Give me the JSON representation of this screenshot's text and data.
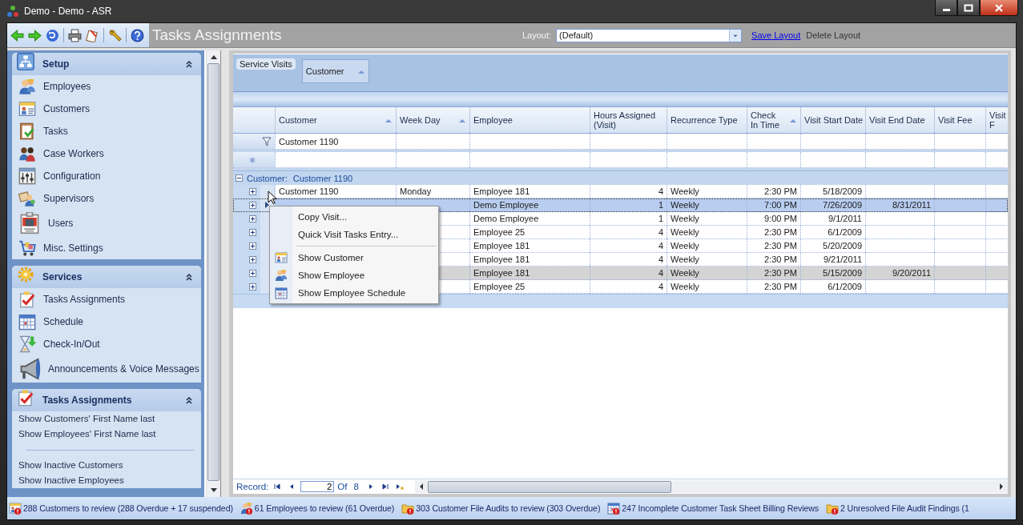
{
  "window": {
    "title": "Demo - Demo - ASR"
  },
  "toolbar": {
    "title": "Tasks Assignments",
    "layout_label": "Layout:",
    "layout_value": "(Default)",
    "save_link": "Save Layout",
    "delete_link": "Delete Layout"
  },
  "sidebar": {
    "groups": [
      {
        "title": "Setup",
        "expanded": true,
        "items": [
          "Employees",
          "Customers",
          "Tasks",
          "Case Workers",
          "Configuration",
          "Supervisors",
          "Users",
          "Misc. Settings"
        ]
      },
      {
        "title": "Services",
        "expanded": true,
        "items": [
          "Tasks Assignments",
          "Schedule",
          "Check-In/Out",
          "Announcements & Voice Messages"
        ]
      },
      {
        "title": "Tasks Assignments",
        "expanded": true,
        "link_sets": [
          [
            "Show Customers' First Name last",
            "Show Employees' First Name last"
          ],
          [
            "Show Inactive Customers",
            "Show Inactive Employees"
          ]
        ]
      }
    ]
  },
  "grid": {
    "group_panel": {
      "label": "Service Visits",
      "group_by": "Customer"
    },
    "columns": [
      {
        "label": "Customer",
        "sorted": true
      },
      {
        "label": "Week Day",
        "sorted": true
      },
      {
        "label": "Employee",
        "sorted": false
      },
      {
        "label": "Hours Assigned (Visit)",
        "sorted": false
      },
      {
        "label": "Recurrence Type",
        "sorted": false
      },
      {
        "label": "Check In Time",
        "sorted": true
      },
      {
        "label": "Visit Start Date",
        "sorted": false
      },
      {
        "label": "Visit End Date",
        "sorted": false
      },
      {
        "label": "Visit Fee",
        "sorted": false
      },
      {
        "label": "Visit F"
      }
    ],
    "filter": {
      "customer": "Customer 1190"
    },
    "group_row": {
      "label": "Customer:",
      "value": "Customer 1190",
      "expanded": true
    },
    "rows": [
      {
        "customer": "Customer 1190",
        "week_day": "Monday",
        "employee": "Employee 181",
        "hours": "4",
        "recurrence": "Weekly",
        "check_in": "2:30 PM",
        "start_date": "5/18/2009",
        "selected": false,
        "highlighted": false,
        "expanded": false
      },
      {
        "employee": "Demo Employee",
        "hours": "1",
        "recurrence": "Weekly",
        "check_in": "7:00 PM",
        "start_date": "7/26/2009",
        "end_date": "8/31/2011",
        "selected": true,
        "highlighted": false,
        "expanded": false
      },
      {
        "employee": "Demo Employee",
        "hours": "1",
        "recurrence": "Weekly",
        "check_in": "9:00 PM",
        "start_date": "9/1/2011",
        "selected": false,
        "highlighted": false,
        "expanded": false
      },
      {
        "employee": "Employee 25",
        "hours": "4",
        "recurrence": "Weekly",
        "check_in": "2:30 PM",
        "start_date": "6/1/2009",
        "selected": false,
        "highlighted": false,
        "expanded": false
      },
      {
        "employee": "Employee 181",
        "hours": "4",
        "recurrence": "Weekly",
        "check_in": "2:30 PM",
        "start_date": "5/20/2009",
        "selected": false,
        "highlighted": false,
        "expanded": false
      },
      {
        "employee": "Employee 181",
        "hours": "4",
        "recurrence": "Weekly",
        "check_in": "2:30 PM",
        "start_date": "9/21/2011",
        "selected": false,
        "highlighted": false,
        "expanded": false
      },
      {
        "employee": "Employee 181",
        "hours": "4",
        "recurrence": "Weekly",
        "check_in": "2:30 PM",
        "start_date": "5/15/2009",
        "end_date": "9/20/2011",
        "selected": false,
        "highlighted": true,
        "expanded": false
      },
      {
        "employee": "Employee 25",
        "hours": "4",
        "recurrence": "Weekly",
        "check_in": "2:30 PM",
        "start_date": "6/1/2009",
        "selected": false,
        "highlighted": false,
        "expanded": false
      }
    ],
    "context_menu": [
      {
        "kind": "command",
        "label": "Copy Visit..."
      },
      {
        "kind": "command",
        "label": "Quick Visit Tasks Entry..."
      },
      {
        "kind": "separator"
      },
      {
        "kind": "command",
        "label": "Show Customer"
      },
      {
        "kind": "command",
        "label": "Show Employee"
      },
      {
        "kind": "command",
        "label": "Show Employee Schedule"
      }
    ],
    "navigator": {
      "label": "Record:",
      "current": "2",
      "of": "Of",
      "total": "8"
    }
  },
  "status_bar": [
    "288 Customers to review (288 Overdue + 17 suspended)",
    "61 Employees to review (61 Overdue)",
    "303 Customer File Audits to review (303 Overdue)",
    "247 Incomplete Customer Task Sheet Billing Reviews",
    "2 Unresolved File Audit Findings (1"
  ]
}
